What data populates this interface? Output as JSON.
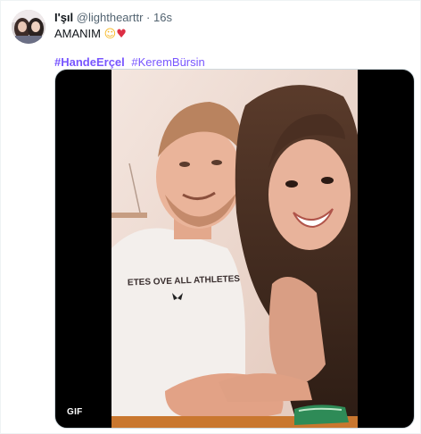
{
  "tweet": {
    "display_name": "I'şıl",
    "handle": "@lighthearttr",
    "separator": "·",
    "time": "16s",
    "text": "AMANIM",
    "emoji_smile": "☺",
    "emoji_heart": "♥",
    "hashtags": [
      "#HandeErçel",
      "#KeremBürsin"
    ],
    "media": {
      "badge": "GIF",
      "shirt_text": "ETES OVE ALL ATHLETES"
    }
  },
  "colors": {
    "hashtag": "#7856ff",
    "secondary_text": "#536471",
    "primary_text": "#0f1419",
    "heart": "#dd2e44"
  }
}
